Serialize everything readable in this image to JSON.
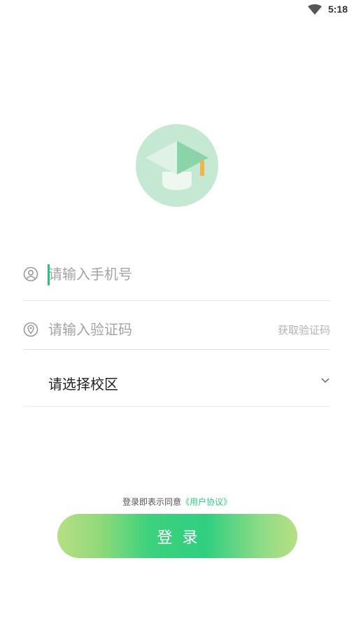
{
  "status_bar": {
    "time": "5:18"
  },
  "form": {
    "phone": {
      "placeholder": "请输入手机号",
      "value": ""
    },
    "code": {
      "placeholder": "请输入验证码",
      "value": "",
      "get_code_label": "获取验证码"
    },
    "campus": {
      "selected": "请选择校区"
    }
  },
  "agreement": {
    "prefix": "登录即表示同意",
    "link": "《用户协议》"
  },
  "login_button": {
    "label": "登录"
  },
  "colors": {
    "accent": "#2fcb7b",
    "logo_circle": "#c4e8d2",
    "logo_triangle": "#8bd4a9",
    "logo_tassel": "#f0b54a"
  }
}
